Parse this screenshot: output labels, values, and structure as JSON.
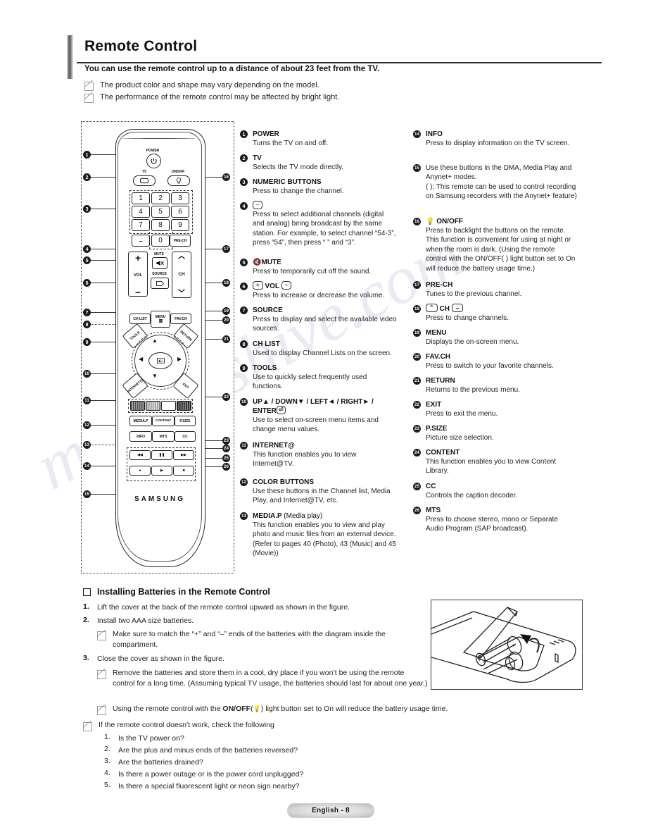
{
  "header": {
    "title": "Remote Control",
    "lead": "You can use the remote control up to a distance of about 23 feet from the TV.",
    "notes": [
      "The product color and shape may vary depending on the model.",
      "The performance of the remote control may be affected by bright light."
    ]
  },
  "remote": {
    "brand": "SAMSUNG",
    "labels": {
      "power": "POWER",
      "tv": "TV",
      "onoff": "ON/OFF",
      "mute": "MUTE",
      "vol": "VOL",
      "source": "SOURCE",
      "ch": "CH",
      "prech": "PRE-CH",
      "chlist": "CH LIST",
      "menu": "MENU",
      "favch": "FAV.CH",
      "tools": "TOOLS",
      "return": "RETURN",
      "internet": "INTERNET@",
      "exit": "EXIT",
      "mediap": "MEDIA.P",
      "content": "CONTENT",
      "psize": "P.SIZE",
      "info": "INFO",
      "mts": "MTS",
      "cc": "CC"
    },
    "numeric_keys": [
      "1",
      "2",
      "3",
      "4",
      "5",
      "6",
      "7",
      "8",
      "9",
      "0"
    ],
    "markers_left": [
      "1",
      "2",
      "3",
      "4",
      "5",
      "6",
      "7",
      "8",
      "9",
      "10",
      "11",
      "12",
      "13",
      "14",
      "15"
    ],
    "markers_right": [
      "16",
      "17",
      "18",
      "19",
      "20",
      "21",
      "22",
      "23",
      "24",
      "25",
      "26"
    ]
  },
  "descriptions_left": [
    {
      "num": "1",
      "title": "POWER",
      "text": "Turns the TV on and off."
    },
    {
      "num": "2",
      "title": "TV",
      "text": "Selects the TV mode directly."
    },
    {
      "num": "3",
      "title": "NUMERIC BUTTONS",
      "text": "Press to change the channel."
    },
    {
      "num": "4",
      "title": "",
      "text": "Press to select additional channels (digital and analog) being broadcast by the same station. For example, to select channel “54-3”, press “54”, then press “        ” and “3”.",
      "keycap": "–"
    },
    {
      "num": "5",
      "title": "MUTE",
      "text": "Press to temporarily cut off the sound."
    },
    {
      "num": "6",
      "title": "VOL",
      "text": "Press to increase or decrease the volume."
    },
    {
      "num": "7",
      "title": "SOURCE",
      "text": "Press to display and select the available video sources."
    },
    {
      "num": "8",
      "title": "CH LIST",
      "text": "Used to display Channel Lists on the screen."
    },
    {
      "num": "9",
      "title": "TOOLS",
      "text": "Use to quickly select frequently used functions."
    },
    {
      "num": "10",
      "title": "UP▲ / DOWN▼ / LEFT◄ / RIGHT► / ENTER",
      "text": "Use to select on-screen menu items and change menu values."
    },
    {
      "num": "11",
      "title": "INTERNET@",
      "text": "This function enables you to view Internet@TV."
    },
    {
      "num": "12",
      "title": "COLOR BUTTONS",
      "text": "Use these buttons in the Channel list, Media Play, and Internet@TV, etc."
    },
    {
      "num": "13",
      "title": "MEDIA.P",
      "title_suffix": "(Media play)",
      "text": "This function enables you to view and play photo and music files from an external device. (Refer to pages 40 (Photo), 43 (Music) and 45 (Movie))"
    }
  ],
  "descriptions_right": [
    {
      "num": "14",
      "title": "INFO",
      "text": "Press to display information on the TV screen."
    },
    {
      "num": "15",
      "title": "",
      "text": "Use these buttons in the DMA, Media Play and Anynet+ modes.\n(      ): This remote can be used to control recording on Samsung recorders with the Anynet+ feature)"
    },
    {
      "num": "16",
      "title": "ON/OFF",
      "text": "Press to backlight the buttons on the remote. This function is convenient for using at night or when the room is dark. (Using the remote control with the ON/OFF(   ) light button set to On will reduce the battery usage time.)"
    },
    {
      "num": "17",
      "title": "PRE-CH",
      "text": "Tunes to the previous channel."
    },
    {
      "num": "18",
      "title": "CH",
      "text": "Press to change channels."
    },
    {
      "num": "19",
      "title": "MENU",
      "text": "Displays the on-screen menu."
    },
    {
      "num": "20",
      "title": "FAV.CH",
      "text": "Press to switch to your favorite channels."
    },
    {
      "num": "21",
      "title": "RETURN",
      "text": "Returns to the previous menu."
    },
    {
      "num": "22",
      "title": "EXIT",
      "text": "Press to exit the menu."
    },
    {
      "num": "23",
      "title": "P.SIZE",
      "text": "Picture size selection."
    },
    {
      "num": "24",
      "title": "CONTENT",
      "text": "This function enables you to view Content Library."
    },
    {
      "num": "25",
      "title": "CC",
      "text": "Controls the caption decoder."
    },
    {
      "num": "26",
      "title": "MTS",
      "text": "Press to choose stereo, mono or Separate Audio Program (SAP broadcast)."
    }
  ],
  "battery": {
    "heading": "Installing Batteries in the Remote Control",
    "steps": [
      {
        "n": "1.",
        "t": "Lift the cover at the back of the remote control upward as shown in the figure."
      },
      {
        "n": "2.",
        "t": "Install two AAA size batteries."
      },
      {
        "n": "3.",
        "t": "Close the cover as shown in the figure."
      }
    ],
    "sub_after_2": "Make sure to match the “+” and “–” ends of the batteries with the diagram inside the compartment.",
    "sub_after_3a": "Remove the batteries and store them in a cool, dry place if you won’t be using the remote control for a long time. (Assuming typical TV usage, the batteries should last for about one year.)",
    "sub_after_3b_pre": "Using the remote control with the ",
    "sub_after_3b_bold": "ON/OFF",
    "sub_after_3b_post": "  light button set to On will reduce the battery usage time.",
    "troubleshoot_intro": "If the remote control doesn’t work, check the following",
    "troubleshoot": [
      {
        "n": "1.",
        "t": "Is the TV power on?"
      },
      {
        "n": "2.",
        "t": "Are the plus and minus ends of the batteries reversed?"
      },
      {
        "n": "3.",
        "t": "Are the batteries drained?"
      },
      {
        "n": "4.",
        "t": "Is there a power outage or is the power cord unplugged?"
      },
      {
        "n": "5.",
        "t": "Is there a special fluorescent light or neon sign nearby?"
      }
    ]
  },
  "footer": {
    "page_label": "English - 8"
  },
  "watermark": "manualshive.com"
}
